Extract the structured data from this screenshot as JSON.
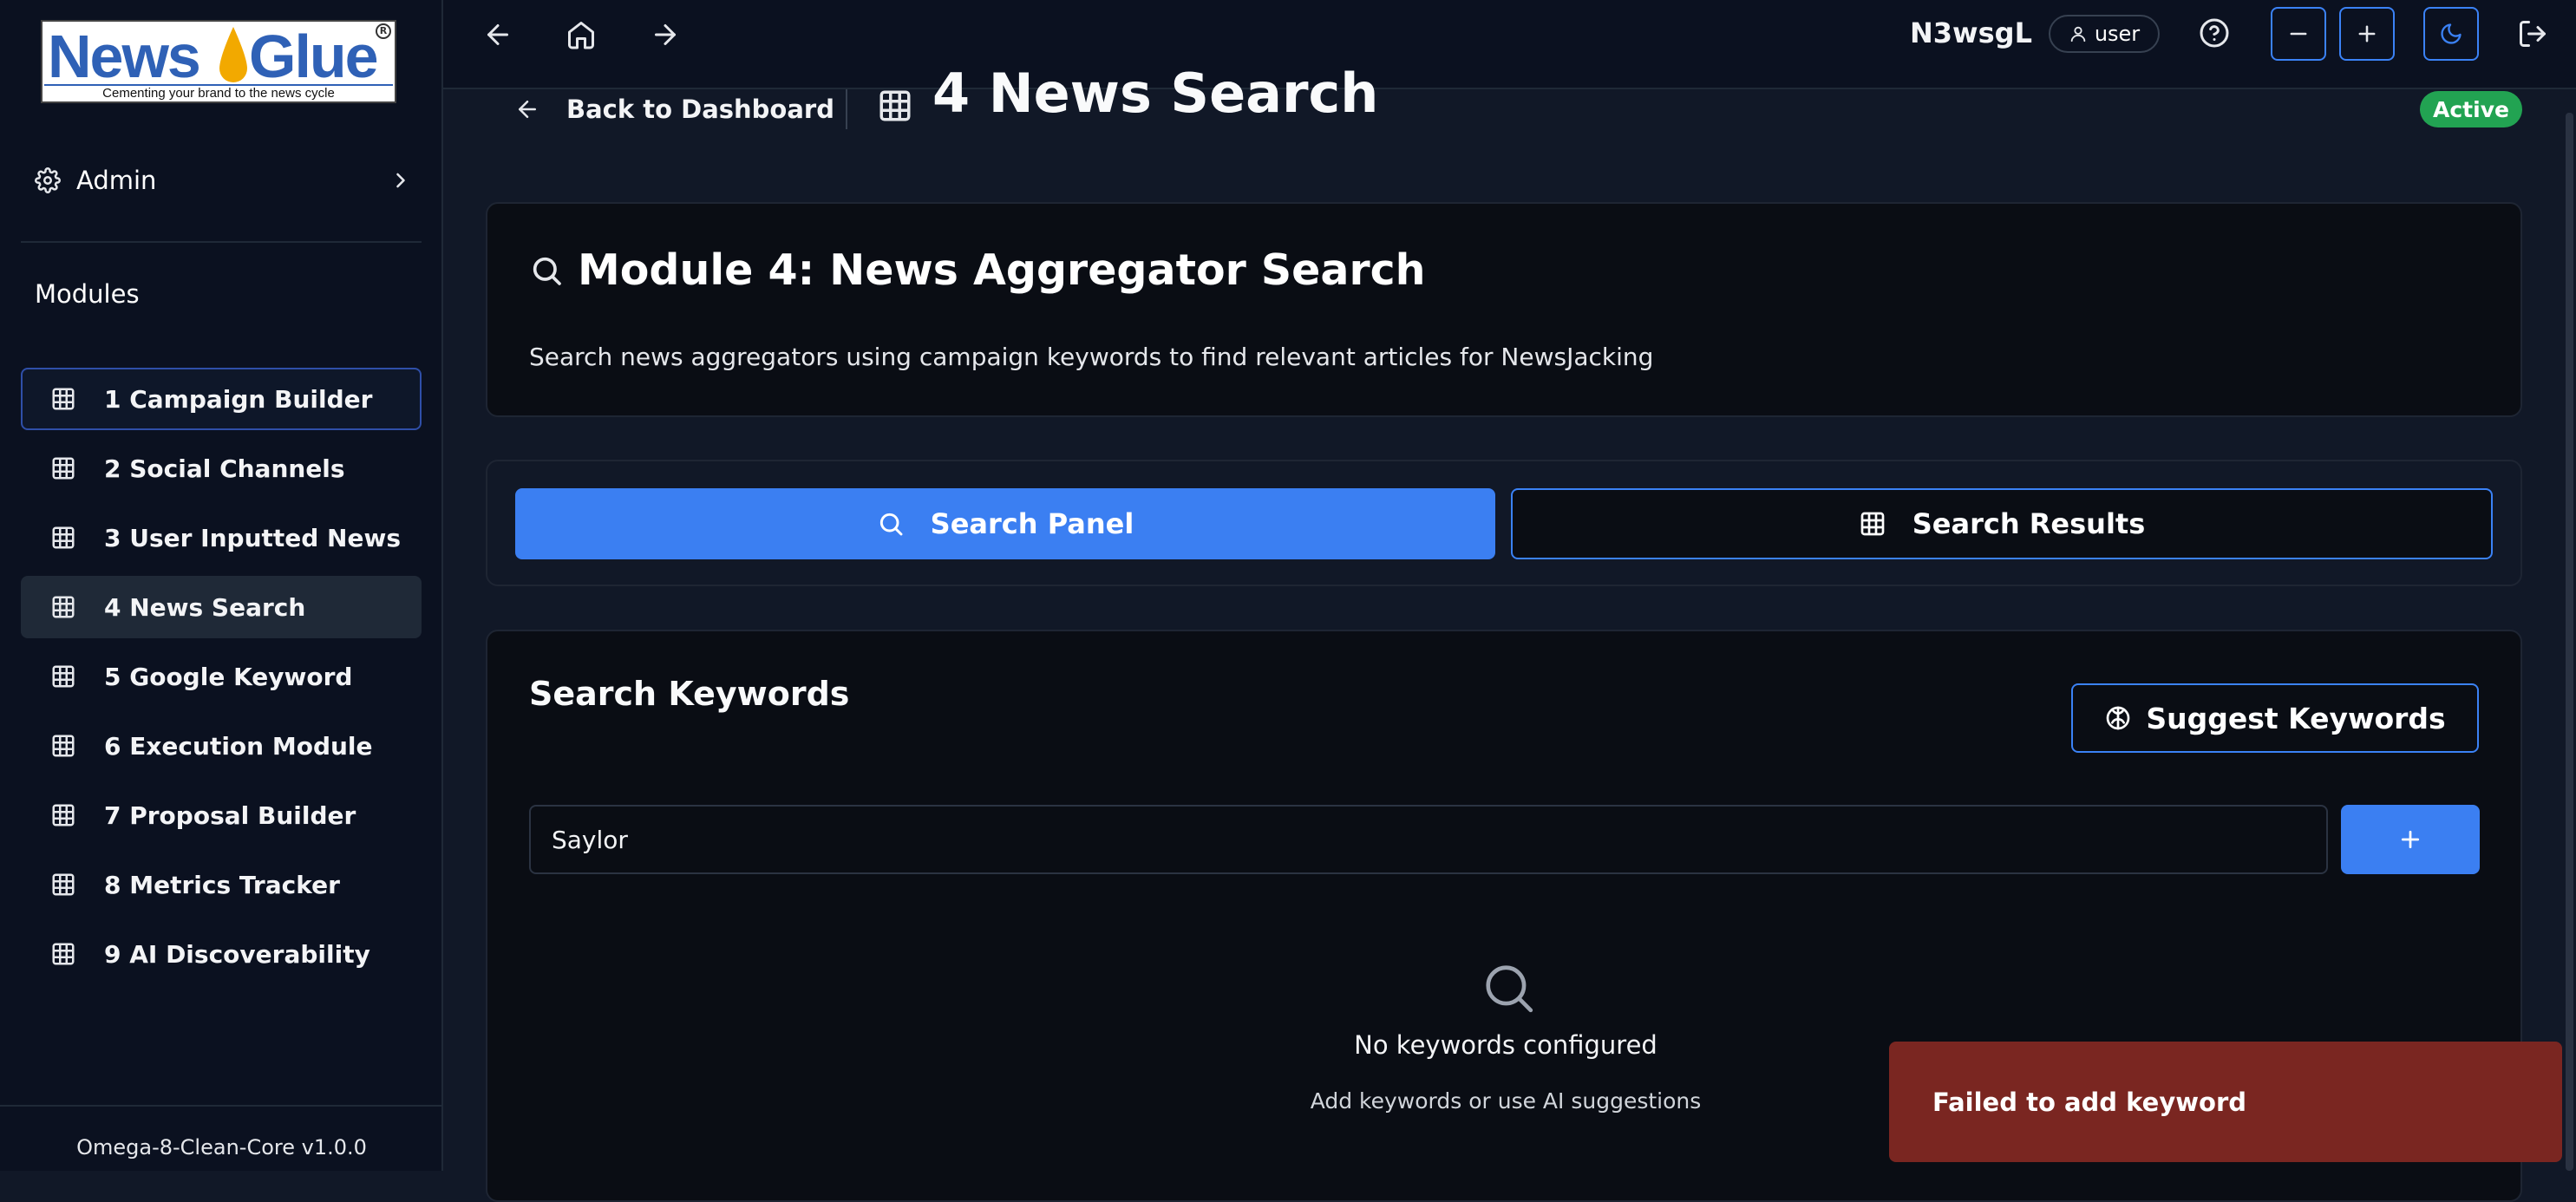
{
  "brand": {
    "logo_word_1": "News",
    "logo_word_2": "Glue",
    "logo_tagline": "Cementing your brand to the news cycle",
    "logo_colors": {
      "blue": "#2f61b6",
      "drop": "#f2a900"
    }
  },
  "sidebar": {
    "admin_label": "Admin",
    "modules_title": "Modules",
    "items": [
      {
        "label": "1 Campaign Builder",
        "icon": "grid-icon"
      },
      {
        "label": "2 Social Channels",
        "icon": "grid-icon"
      },
      {
        "label": "3 User Inputted News",
        "icon": "grid-icon"
      },
      {
        "label": "4 News Search",
        "icon": "grid-icon"
      },
      {
        "label": "5 Google Keyword",
        "icon": "grid-icon"
      },
      {
        "label": "6 Execution Module",
        "icon": "grid-icon"
      },
      {
        "label": "7 Proposal Builder",
        "icon": "grid-icon"
      },
      {
        "label": "8 Metrics Tracker",
        "icon": "grid-icon"
      },
      {
        "label": "9 AI Discoverability",
        "icon": "grid-icon"
      }
    ],
    "version": "Omega-8-Clean-Core v1.0.0"
  },
  "topbar": {
    "user_id": "N3wsgL",
    "user_role": "user",
    "icons": [
      "arrow-left-icon",
      "home-icon",
      "arrow-right-icon",
      "help-icon",
      "zoom-out-icon",
      "zoom-in-icon",
      "moon-icon",
      "logout-icon"
    ]
  },
  "page": {
    "back_label": "Back to Dashboard",
    "title": "4 News Search",
    "status": "Active"
  },
  "hero": {
    "title": "Module 4: News Aggregator Search",
    "description": "Search news aggregators using campaign keywords to find relevant articles for NewsJacking"
  },
  "tabs": {
    "panel_label": "Search Panel",
    "results_label": "Search Results"
  },
  "keywords": {
    "title": "Search Keywords",
    "suggest_label": "Suggest Keywords",
    "input_value": "Saylor",
    "add_label": "+",
    "empty_title": "No keywords configured",
    "empty_subtitle": "Add keywords or use AI suggestions"
  },
  "toast": {
    "message": "Failed to add keyword"
  },
  "colors": {
    "accent": "#3b82f6",
    "success": "#22a352",
    "error": "#7a2621",
    "background": "#111827"
  }
}
